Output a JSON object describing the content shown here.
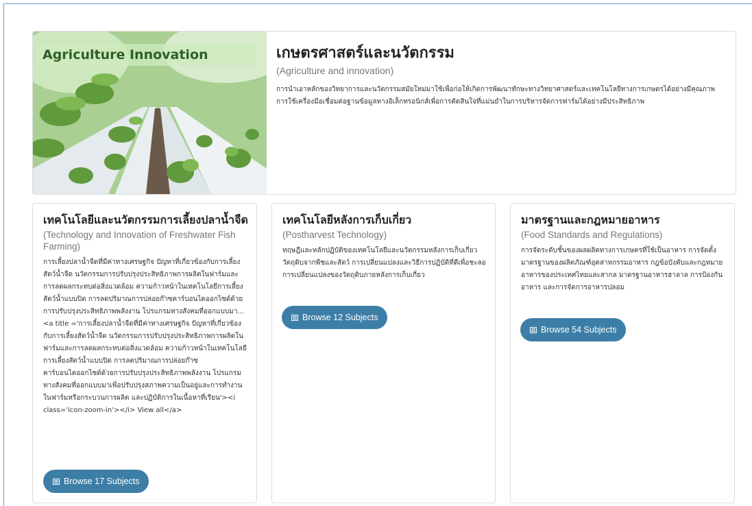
{
  "hero": {
    "image_label": "Agriculture Innovation",
    "title": "เกษตรศาสตร์และนวัตกรรม",
    "subtitle": "(Agriculture and innovation)",
    "description": "การนำเอาหลักของวิทยาการและนวัตกรรมสมัยใหม่มาใช้เพื่อก่อให้เกิดการพัฒนาทักษะทางวิทยาศาสตร์และเทคโนโลยีทางการเกษตรได้อย่างมีคุณภาพ การใช้เครื่องมือเชื่อมต่อฐานข้อมูลทางอิเล็กทรอนิกส์เพื่อการตัดสินใจที่แม่นยำในการบริหารจัดการฟาร์มได้อย่างมีประสิทธิภาพ"
  },
  "cards": [
    {
      "title": "เทคโนโลยีและนวัตกรรมการเลี้ยงปลาน้ำจืด",
      "subtitle": "(Technology and Innovation of Freshwater Fish Farming)",
      "description": "การเลี้ยงปลาน้ำจืดที่มีค่าทางเศรษฐกิจ ปัญหาที่เกี่ยวข้องกับการเลี้ยงสัตว์น้ำจืด นวัตกรรมการปรับปรุงประสิทธิภาพการผลิตในฟาร์มและการลดผลกระทบต่อสิ่งแวดล้อม ความก้าวหน้าในเทคโนโลยีการเลี้ยงสัตว์น้ำแบบปิด การลดปริมาณการปล่อยก๊าซคาร์บอนไดออกไซด์ด้วยการปรับปรุงประสิทธิภาพพลังงาน โปรแกรมทางสังคมที่ออกแบบมา...<a title ='การเลี้ยงปลาน้ำจืดที่มีค่าทางเศรษฐกิจ ปัญหาที่เกี่ยวข้องกับการเลี้ยงสัตว์น้ำจืด นวัตกรรมการปรับปรุงประสิทธิภาพการผลิตในฟาร์มและการลดผลกระทบต่อสิ่งแวดล้อม ความก้าวหน้าในเทคโนโลยีการเลี้ยงสัตว์น้ำแบบปิด การลดปริมาณการปล่อยก๊าซคาร์บอนไดออกไซด์ด้วยการปรับปรุงประสิทธิภาพพลังงาน โปรแกรมทางสังคมที่ออกแบบมาเพื่อปรับปรุงสภาพความเป็นอยู่และการทำงานในฟาร์มหรือกระบวนการผลิต และปฏิบัติการในเนื้อหาที่เรียน'><i class='icon-zoom-in'></i> View all</a>",
      "button": "Browse 17 Subjects"
    },
    {
      "title": "เทคโนโลยีหลังการเก็บเกี่ยว",
      "subtitle": "(Postharvest Technology)",
      "description": "ทฤษฎีและหลักปฏิบัติของเทคโนโลยีและนวัตกรรมหลังการเก็บเกี่ยววัตถุดิบจากพืชและสัตว์ การเปลี่ยนแปลงและวิธีการปฏิบัติที่ดีเพื่อชะลอการเปลี่ยนแปลงของวัตถุดิบภายหลังการเก็บเกี่ยว",
      "button": "Browse 12 Subjects"
    },
    {
      "title": "มาตรฐานและกฎหมายอาหาร",
      "subtitle": "(Food Standards and Regulations)",
      "description": "การจัดระดับชั้นของผลผลิตทางการเกษตรที่ใช้เป็นอาหาร การจัดตั้งมาตรฐานของผลิตภัณฑ์อุตสาหกรรมอาหาร กฎข้อบังคับและกฎหมายอาหารของประเทศไทยและสากล มาตรฐานอาหารฮาลาล การป้องกันอาหาร และการจัดการอาหารปลอม",
      "button": "Browse 54 Subjects"
    }
  ]
}
